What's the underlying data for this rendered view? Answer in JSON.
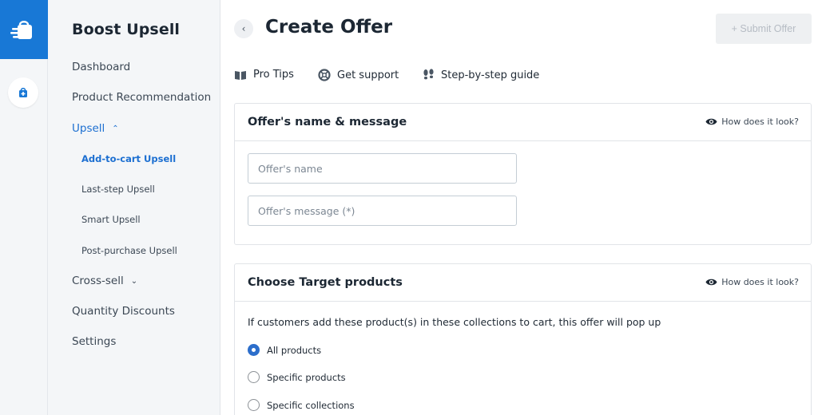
{
  "sidebar": {
    "brand": "Boost Upsell",
    "items": [
      {
        "label": "Dashboard"
      },
      {
        "label": "Product Recommendation"
      },
      {
        "label": "Upsell",
        "chevron": "⌃"
      },
      {
        "label": "Cross-sell",
        "chevron": "⌄"
      },
      {
        "label": "Quantity Discounts"
      },
      {
        "label": "Settings"
      }
    ],
    "upsell_sub": [
      {
        "label": "Add-to-cart Upsell"
      },
      {
        "label": "Last-step Upsell"
      },
      {
        "label": "Smart Upsell"
      },
      {
        "label": "Post-purchase Upsell"
      }
    ]
  },
  "header": {
    "back_icon": "‹",
    "title": "Create Offer",
    "submit_label": "+ Submit Offer"
  },
  "toolbar": {
    "pro_tips": "Pro Tips",
    "get_support": "Get support",
    "guide": "Step-by-step guide"
  },
  "offer_card": {
    "title": "Offer's name & message",
    "how_label": "How does it look?",
    "name_placeholder": "Offer's name",
    "message_placeholder": "Offer's message (*)"
  },
  "target_card": {
    "title": "Choose Target products",
    "how_label": "How does it look?",
    "description": "If customers add these product(s) in these collections to cart, this offer will pop up",
    "options": [
      {
        "label": "All products",
        "selected": true
      },
      {
        "label": "Specific products",
        "selected": false
      },
      {
        "label": "Specific collections",
        "selected": false
      }
    ]
  },
  "colors": {
    "brand_blue": "#1878d6",
    "active_link": "#1c6fd1",
    "radio_selected": "#2c6ecb"
  }
}
